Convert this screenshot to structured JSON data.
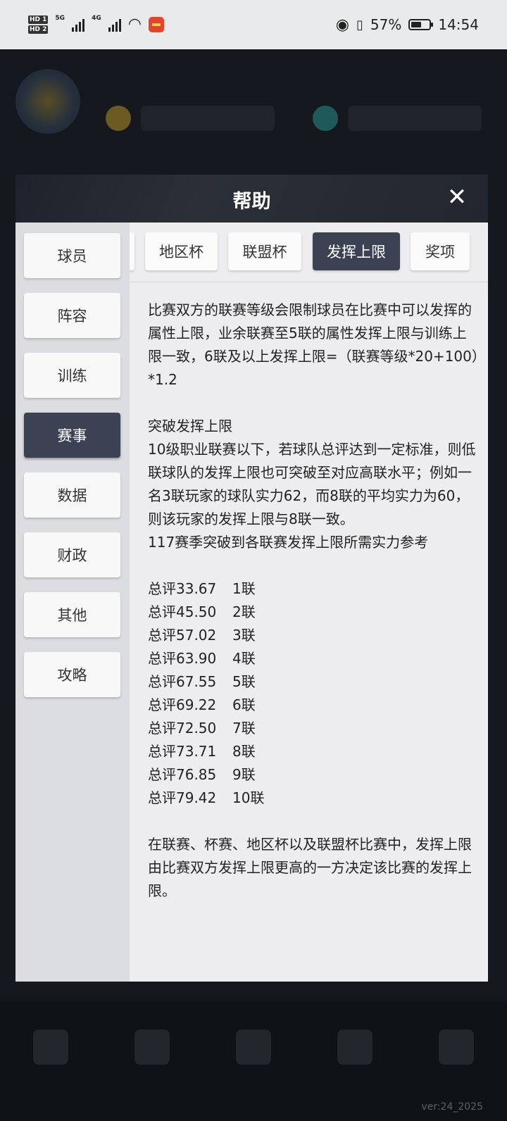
{
  "status_bar": {
    "hd1": "HD 1",
    "hd2": "HD 2",
    "net1": "5G",
    "net2": "4G",
    "battery_percent_text": "57%",
    "battery_level": 0.57,
    "time": "14:54"
  },
  "dialog": {
    "title": "帮助",
    "close_icon": "close-icon",
    "sidebar": [
      {
        "label": "球员",
        "active": false
      },
      {
        "label": "阵容",
        "active": false
      },
      {
        "label": "训练",
        "active": false
      },
      {
        "label": "赛事",
        "active": true
      },
      {
        "label": "数据",
        "active": false
      },
      {
        "label": "财政",
        "active": false
      },
      {
        "label": "其他",
        "active": false
      },
      {
        "label": "攻略",
        "active": false
      }
    ],
    "tabs": [
      {
        "label": "",
        "active": false
      },
      {
        "label": "地区杯",
        "active": false
      },
      {
        "label": "联盟杯",
        "active": false
      },
      {
        "label": "发挥上限",
        "active": true
      },
      {
        "label": "奖项",
        "active": false
      }
    ],
    "content": {
      "p1": "比赛双方的联赛等级会限制球员在比赛中可以发挥的属性上限，业余联赛至5联的属性发挥上限与训练上限一致，6联及以上发挥上限=（联赛等级*20+100）*1.2",
      "p2_title": "突破发挥上限",
      "p2_body": "10级职业联赛以下，若球队总评达到一定标准，则低联球队的发挥上限也可突破至对应高联水平；例如一名3联玩家的球队实力62，而8联的平均实力为60，则该玩家的发挥上限与8联一致。",
      "p2_ref": "117赛季突破到各联赛发挥上限所需实力参考",
      "table": [
        {
          "score": "总评33.67",
          "league": "1联"
        },
        {
          "score": "总评45.50",
          "league": "2联"
        },
        {
          "score": "总评57.02",
          "league": "3联"
        },
        {
          "score": "总评63.90",
          "league": "4联"
        },
        {
          "score": "总评67.55",
          "league": "5联"
        },
        {
          "score": "总评69.22",
          "league": "6联"
        },
        {
          "score": "总评72.50",
          "league": "7联"
        },
        {
          "score": "总评73.71",
          "league": "8联"
        },
        {
          "score": "总评76.85",
          "league": "9联"
        },
        {
          "score": "总评79.42",
          "league": "10联"
        }
      ],
      "p3": "在联赛、杯赛、地区杯以及联盟杯比赛中，发挥上限由比赛双方发挥上限更高的一方决定该比赛的发挥上限。"
    }
  },
  "footer": {
    "version": "ver:24_2025"
  },
  "colors": {
    "active_button": "#3c4254",
    "dialog_bg": "#efeff1",
    "header_bg": "#22262e"
  }
}
